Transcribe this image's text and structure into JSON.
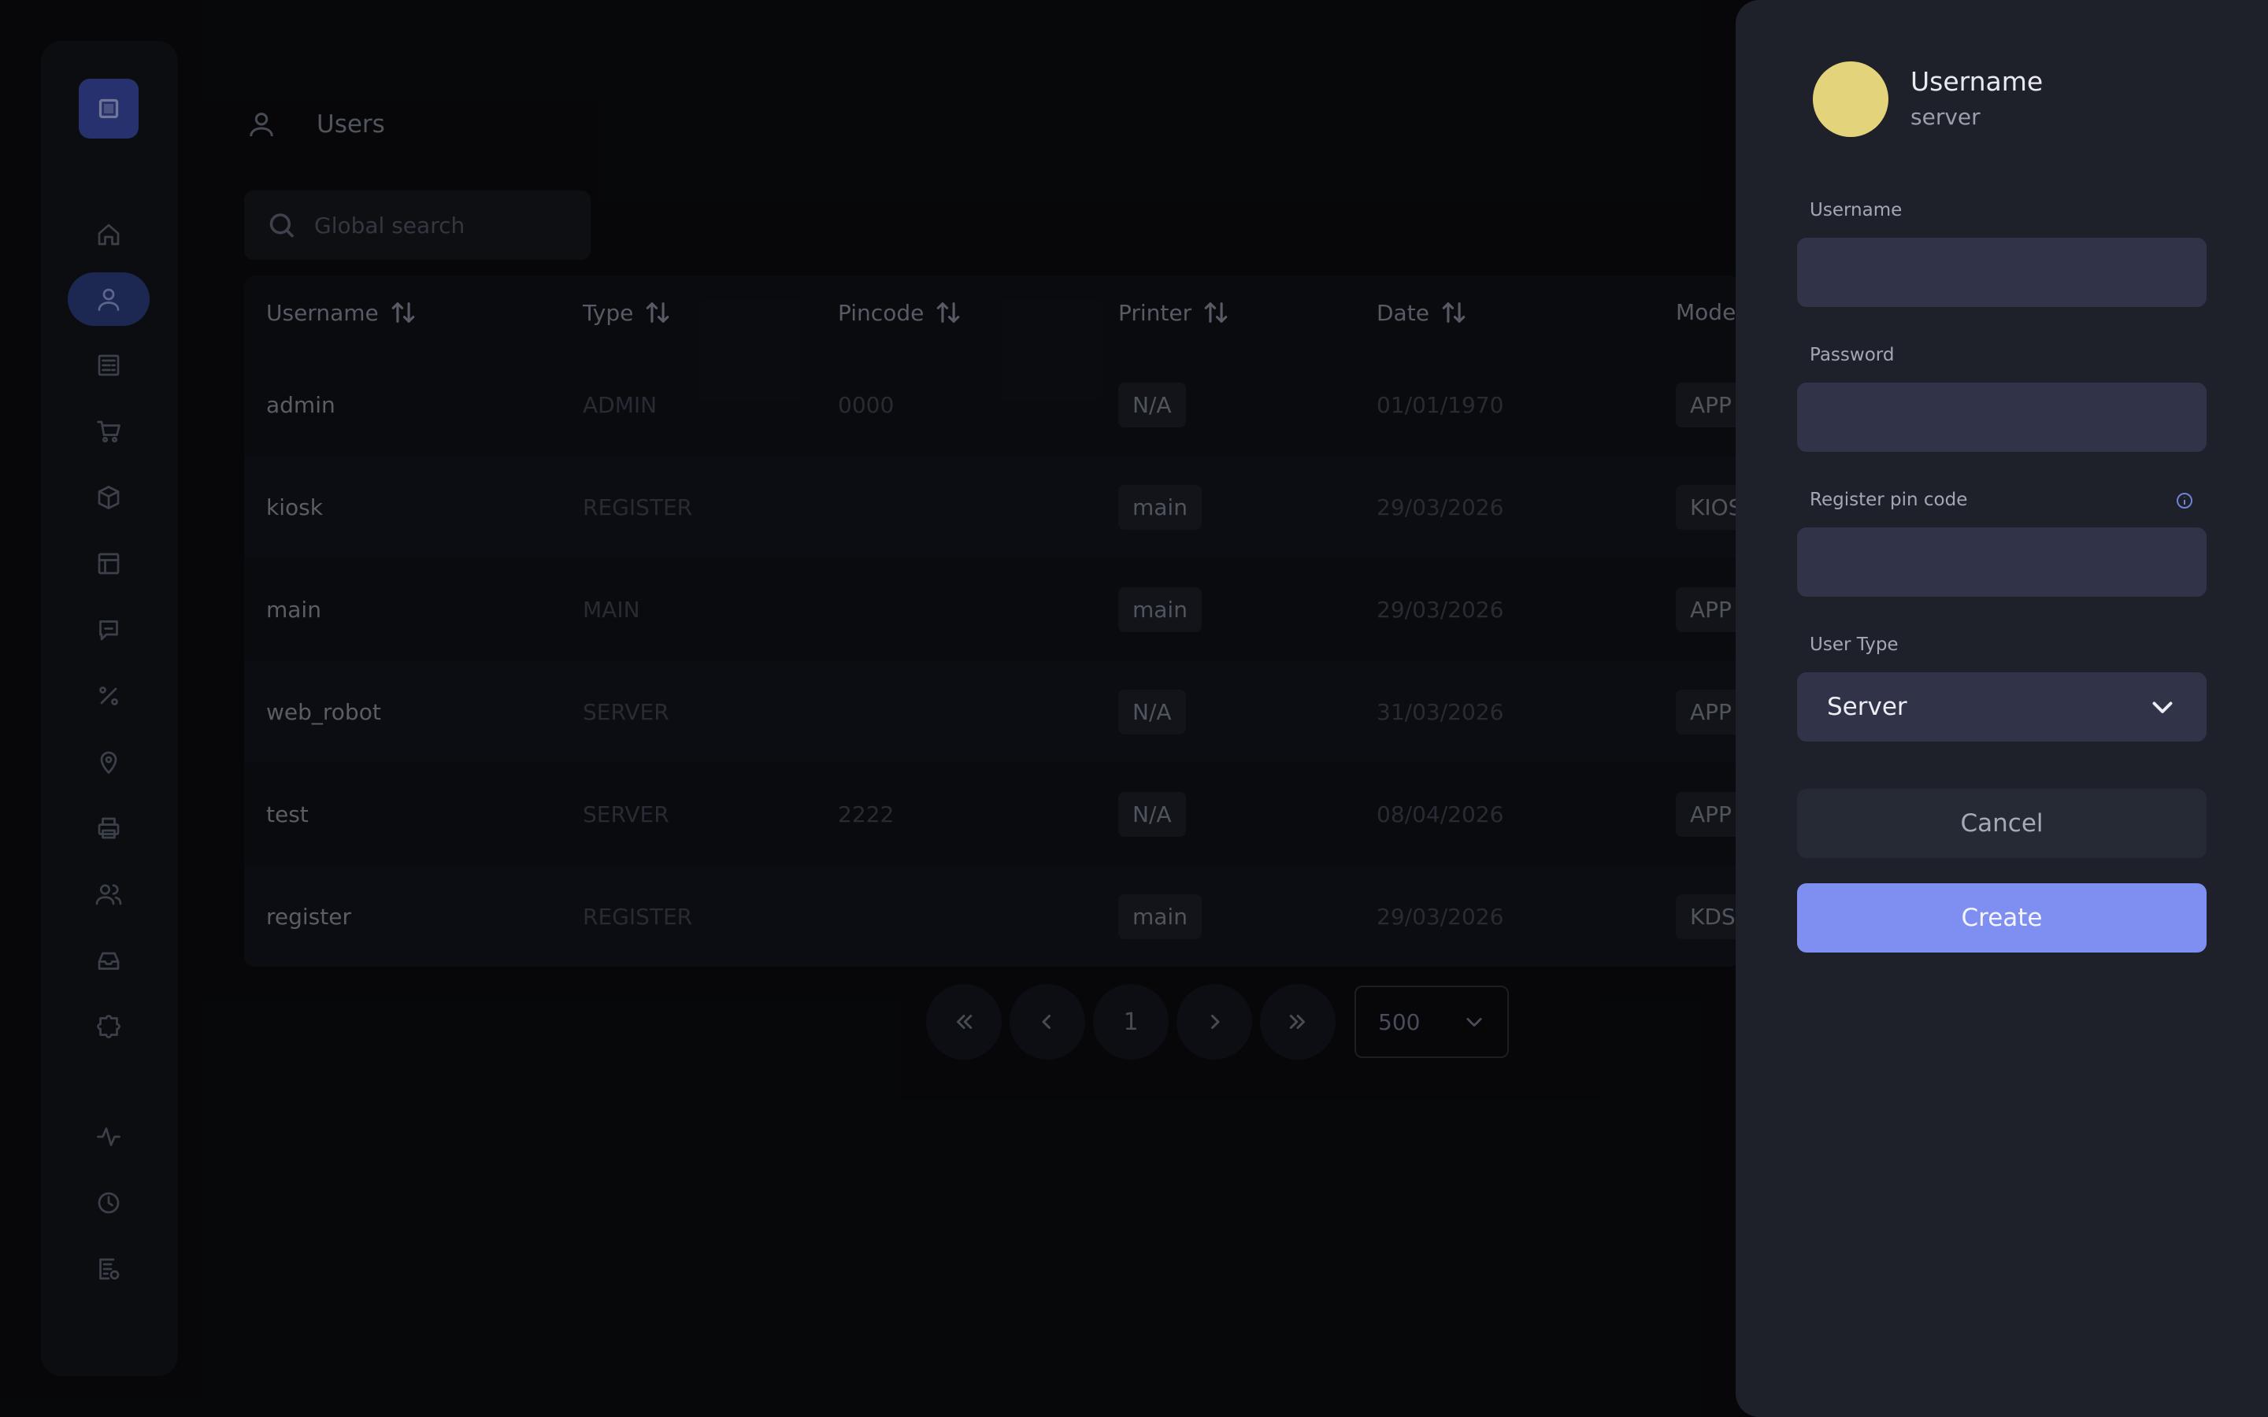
{
  "page": {
    "title": "Users"
  },
  "search": {
    "placeholder": "Global search"
  },
  "nav": {
    "items": [
      "home-icon",
      "user-icon",
      "receipt-icon",
      "cart-icon",
      "box-icon",
      "layout-icon",
      "message-icon",
      "percent-icon",
      "location-icon",
      "printer-icon",
      "users-icon",
      "inbox-icon",
      "puzzle-icon",
      "activity-icon",
      "clock-icon",
      "report-icon"
    ],
    "active": "user-icon"
  },
  "table": {
    "columns": [
      "Username",
      "Type",
      "Pincode",
      "Printer",
      "Date",
      "Mode"
    ],
    "rows": [
      {
        "username": "admin",
        "type": "ADMIN",
        "pincode": "0000",
        "printer": "N/A",
        "date": "01/01/1970",
        "mode": "APP"
      },
      {
        "username": "kiosk",
        "type": "REGISTER",
        "pincode": "",
        "printer": "main",
        "date": "29/03/2026",
        "mode": "KIOS"
      },
      {
        "username": "main",
        "type": "MAIN",
        "pincode": "",
        "printer": "main",
        "date": "29/03/2026",
        "mode": "APP"
      },
      {
        "username": "web_robot",
        "type": "SERVER",
        "pincode": "",
        "printer": "N/A",
        "date": "31/03/2026",
        "mode": "APP"
      },
      {
        "username": "test",
        "type": "SERVER",
        "pincode": "2222",
        "printer": "N/A",
        "date": "08/04/2026",
        "mode": "APP"
      },
      {
        "username": "register",
        "type": "REGISTER",
        "pincode": "",
        "printer": "main",
        "date": "29/03/2026",
        "mode": "KDS"
      }
    ]
  },
  "pagination": {
    "current_page": "1",
    "page_size": "500",
    "first": "«",
    "prev": "‹",
    "next": "›",
    "last": "»"
  },
  "drawer": {
    "profile_name": "Username",
    "profile_type": "server",
    "username_label": "Username",
    "username_value": "",
    "password_label": "Password",
    "password_value": "",
    "pincode_label": "Register pin code",
    "pincode_value": "",
    "user_type_label": "User Type",
    "user_type_value": "Server",
    "cancel_label": "Cancel",
    "create_label": "Create",
    "avatar_color": "#e3d47c",
    "accent_color": "#7f8ff1"
  }
}
